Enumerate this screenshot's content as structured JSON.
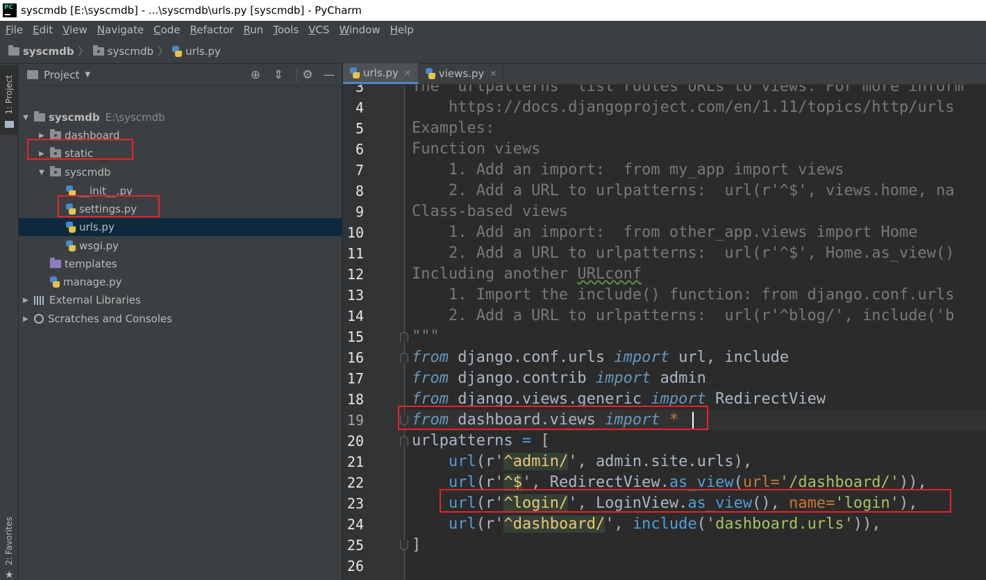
{
  "window": {
    "title": "syscmdb [E:\\syscmdb] - ...\\syscmdb\\urls.py [syscmdb] - PyCharm",
    "app_icon_text": "PC"
  },
  "menubar": {
    "items": [
      {
        "u": "F",
        "rest": "ile"
      },
      {
        "u": "E",
        "rest": "dit"
      },
      {
        "u": "V",
        "rest": "iew"
      },
      {
        "u": "N",
        "rest": "avigate"
      },
      {
        "u": "C",
        "rest": "ode"
      },
      {
        "u": "R",
        "rest": "efactor"
      },
      {
        "u": "R",
        "rest": "un"
      },
      {
        "u": "T",
        "rest": "ools"
      },
      {
        "u": "V",
        "rest": "CS"
      },
      {
        "u": "W",
        "rest": "indow"
      },
      {
        "u": "H",
        "rest": "elp"
      }
    ]
  },
  "breadcrumb": [
    "syscmdb",
    "syscmdb",
    "urls.py"
  ],
  "stripe": {
    "project_label": "1: Project",
    "favorites_label": "2: Favorites"
  },
  "project_panel": {
    "title": "Project",
    "tree": [
      {
        "label": "syscmdb",
        "extra": "E:\\syscmdb",
        "depth": 0,
        "expanded": true,
        "kind": "folder",
        "bold": true
      },
      {
        "label": "dashboard",
        "depth": 1,
        "expanded": false,
        "kind": "folder"
      },
      {
        "label": "static",
        "depth": 1,
        "expanded": false,
        "kind": "folder"
      },
      {
        "label": "syscmdb",
        "depth": 1,
        "expanded": true,
        "kind": "folder"
      },
      {
        "label": "__init__.py",
        "depth": 2,
        "kind": "py"
      },
      {
        "label": "settings.py",
        "depth": 2,
        "kind": "py"
      },
      {
        "label": "urls.py",
        "depth": 2,
        "kind": "py",
        "selected": true
      },
      {
        "label": "wsgi.py",
        "depth": 2,
        "kind": "py"
      },
      {
        "label": "templates",
        "depth": 1,
        "kind": "folder-purple"
      },
      {
        "label": "manage.py",
        "depth": 1,
        "kind": "py"
      },
      {
        "label": "External Libraries",
        "depth": 0,
        "expanded": false,
        "kind": "libs"
      },
      {
        "label": "Scratches and Consoles",
        "depth": 0,
        "expanded": false,
        "kind": "scratch"
      }
    ]
  },
  "tabs": [
    {
      "label": "urls.py",
      "active": true
    },
    {
      "label": "views.py",
      "active": false
    }
  ],
  "editor": {
    "current_line": 19,
    "lines": [
      {
        "n": "3",
        "parts": [
          [
            "doc",
            "The `urlpatterns` list routes URLs to views. For more inform"
          ]
        ]
      },
      {
        "n": "4",
        "parts": [
          [
            "doc",
            "    https://docs.djangoproject.com/en/1.11/topics/http/urls"
          ]
        ]
      },
      {
        "n": "5",
        "parts": [
          [
            "doc",
            "Examples:"
          ]
        ]
      },
      {
        "n": "6",
        "parts": [
          [
            "doc",
            "Function views"
          ]
        ]
      },
      {
        "n": "7",
        "parts": [
          [
            "doc",
            "    1. Add an import:  from my_app import views"
          ]
        ]
      },
      {
        "n": "8",
        "parts": [
          [
            "doc",
            "    2. Add a URL to urlpatterns:  url(r'^$', views.home, na"
          ]
        ]
      },
      {
        "n": "9",
        "parts": [
          [
            "doc",
            "Class-based views"
          ]
        ]
      },
      {
        "n": "10",
        "parts": [
          [
            "doc",
            "    1. Add an import:  from other_app.views import Home"
          ]
        ]
      },
      {
        "n": "11",
        "parts": [
          [
            "doc",
            "    2. Add a URL to urlpatterns:  url(r'^$', Home.as_view()"
          ]
        ]
      },
      {
        "n": "12",
        "parts": [
          [
            "doc",
            "Including another "
          ],
          [
            "docwavy",
            "URLconf"
          ]
        ]
      },
      {
        "n": "13",
        "parts": [
          [
            "doc",
            "    1. Import the include() function: from django.conf.urls"
          ]
        ]
      },
      {
        "n": "14",
        "parts": [
          [
            "doc",
            "    2. Add a URL to urlpatterns:  url(r'^blog/', include('b"
          ]
        ]
      },
      {
        "n": "15",
        "parts": [
          [
            "doc",
            "\"\"\""
          ]
        ]
      },
      {
        "n": "16",
        "parts": [
          [
            "kw",
            "from"
          ],
          [
            "op",
            " django.conf.urls "
          ],
          [
            "kw",
            "import"
          ],
          [
            "op",
            " url, include"
          ]
        ]
      },
      {
        "n": "17",
        "parts": [
          [
            "kw",
            "from"
          ],
          [
            "op",
            " django.contrib "
          ],
          [
            "kw",
            "import"
          ],
          [
            "op",
            " admin"
          ]
        ]
      },
      {
        "n": "18",
        "parts": [
          [
            "kw",
            "from"
          ],
          [
            "op",
            " django.views.generic "
          ],
          [
            "kw",
            "import"
          ],
          [
            "op",
            " RedirectView"
          ]
        ]
      },
      {
        "n": "19",
        "parts": [
          [
            "kw",
            "from"
          ],
          [
            "op",
            " dashboard.views "
          ],
          [
            "kw",
            "import"
          ],
          [
            "op",
            " "
          ],
          [
            "par",
            "*"
          ]
        ]
      },
      {
        "n": "20",
        "parts": [
          [
            "op",
            "urlpatterns "
          ],
          [
            "fn",
            "="
          ],
          [
            "op",
            " ["
          ]
        ]
      },
      {
        "n": "21",
        "parts": [
          [
            "op",
            "    "
          ],
          [
            "fn",
            "url"
          ],
          [
            "op",
            "(r'"
          ],
          [
            "strb",
            "^admin/"
          ],
          [
            "op",
            "', admin.site.urls),"
          ]
        ]
      },
      {
        "n": "22",
        "parts": [
          [
            "op",
            "    "
          ],
          [
            "fn",
            "url"
          ],
          [
            "op",
            "(r'"
          ],
          [
            "strb",
            "^$"
          ],
          [
            "op",
            "', RedirectView."
          ],
          [
            "fn",
            "as_view"
          ],
          [
            "op",
            "("
          ],
          [
            "par",
            "url="
          ],
          [
            "str",
            "'/dashboard/'"
          ],
          [
            "op",
            ")),"
          ]
        ]
      },
      {
        "n": "23",
        "parts": [
          [
            "op",
            "    "
          ],
          [
            "fn",
            "url"
          ],
          [
            "op",
            "(r'"
          ],
          [
            "strb",
            "^login/"
          ],
          [
            "op",
            "', LoginView."
          ],
          [
            "fn",
            "as_view"
          ],
          [
            "op",
            "(), "
          ],
          [
            "par",
            "name="
          ],
          [
            "str",
            "'login'"
          ],
          [
            "op",
            "),"
          ]
        ]
      },
      {
        "n": "24",
        "parts": [
          [
            "op",
            "    "
          ],
          [
            "fn",
            "url"
          ],
          [
            "op",
            "(r'"
          ],
          [
            "strb",
            "^dashboard/"
          ],
          [
            "op",
            "', "
          ],
          [
            "fn",
            "include"
          ],
          [
            "op",
            "("
          ],
          [
            "str",
            "'dashboard.urls'"
          ],
          [
            "op",
            ")),"
          ]
        ]
      },
      {
        "n": "25",
        "parts": [
          [
            "op",
            "]"
          ]
        ]
      },
      {
        "n": "26",
        "parts": []
      }
    ]
  },
  "colors": {
    "annotation_red": "#e8222a",
    "selection_blue": "#0d293e",
    "tab_underline": "#4a88c7"
  }
}
